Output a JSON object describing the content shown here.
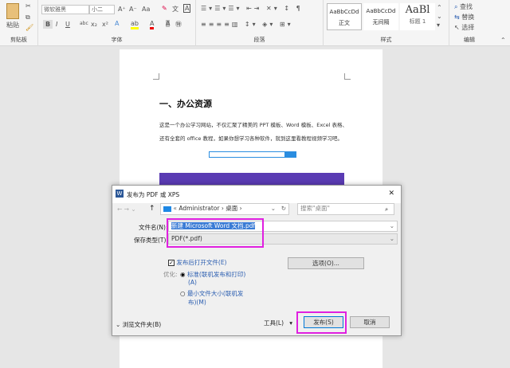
{
  "ribbon": {
    "clipboard": {
      "paste": "粘贴",
      "label": "剪贴板"
    },
    "font": {
      "name": "微软雅黑",
      "size": "小二",
      "label": "字体",
      "bold": "B",
      "italic": "I",
      "underline": "U",
      "strike": "abc",
      "sub": "x₂",
      "sup": "x²",
      "case": "Aa"
    },
    "paragraph": {
      "label": "段落"
    },
    "styles": {
      "label": "样式",
      "items": [
        {
          "preview": "AaBbCcDd",
          "name": "正文"
        },
        {
          "preview": "AaBbCcDd",
          "name": "无间隔"
        },
        {
          "preview": "AaBl",
          "name": "标题 1"
        }
      ]
    },
    "editing": {
      "label": "编辑",
      "find": "查找",
      "replace": "替换",
      "select": "选择"
    }
  },
  "document": {
    "heading": "一、办公资源",
    "para1": "这是一个办公学习网站，不仅汇聚了精美的 PPT 模板、Word 模板、Excel 表格、",
    "para2": "还有全套的 office 教程，如果你想学习各种软件，就到这里看教程视频学习吧。"
  },
  "dialog": {
    "title": "发布为 PDF 或 XPS",
    "path": [
      "Administrator",
      "桌面"
    ],
    "search_placeholder": "搜索\"桌面\"",
    "filename_label": "文件名(N):",
    "filename": "新建 Microsoft Word 文档.pdf",
    "filetype_label": "保存类型(T):",
    "filetype": "PDF(*.pdf)",
    "open_after": "发布后打开文件(E)",
    "open_after_checked": true,
    "optimize_label": "优化:",
    "opt_standard": "标准(联机发布和打印)",
    "opt_standard_key": "(A)",
    "opt_min": "最小文件大小(联机发",
    "opt_min_key": "布)(M)",
    "selected_option": "standard",
    "options_btn": "选项(O)...",
    "browse": "浏览文件夹(B)",
    "tools": "工具(L)",
    "publish": "发布(S)",
    "cancel": "取消",
    "close": "✕",
    "highlight_color": "#e020e0"
  }
}
